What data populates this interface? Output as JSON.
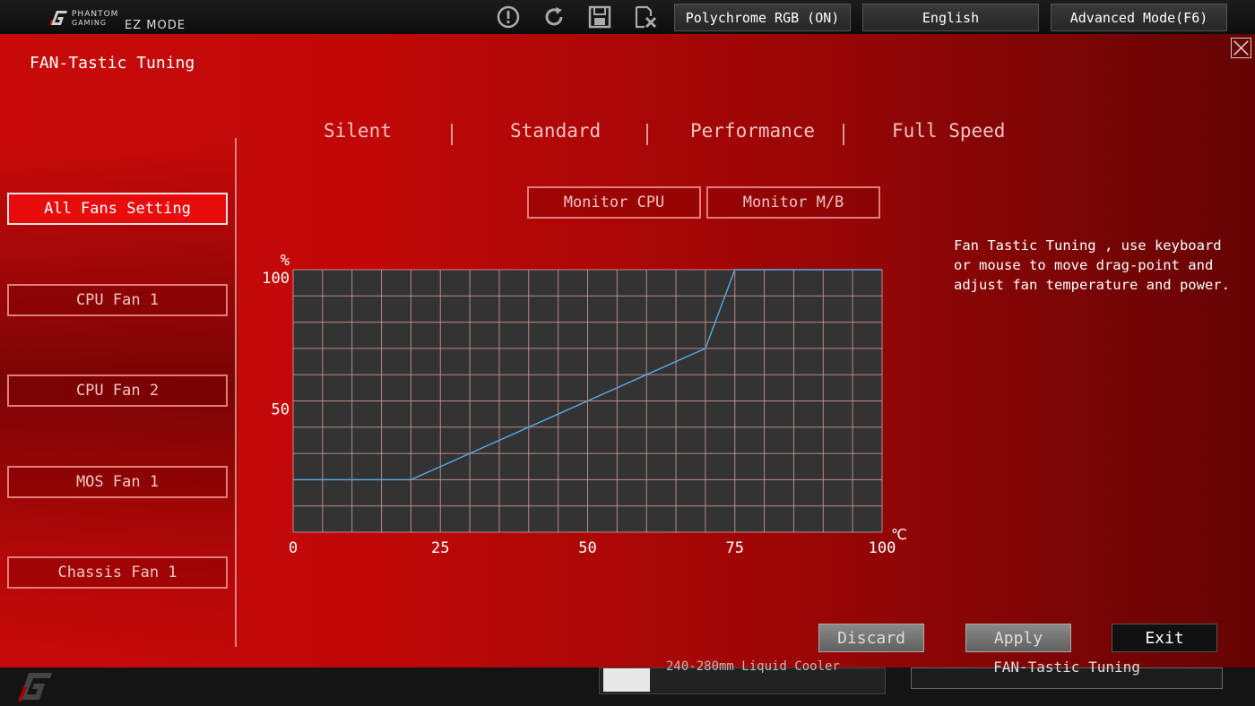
{
  "header": {
    "brand_line1": "PHANTOM",
    "brand_line2": "GAMING",
    "mode_label": "EZ MODE",
    "icons": [
      "warning-icon",
      "refresh-icon",
      "save-icon",
      "discard-icon"
    ],
    "polychrome_label": "Polychrome RGB (ON)",
    "language_label": "English",
    "advanced_label": "Advanced Mode(F6)"
  },
  "panel": {
    "title": "FAN-Tastic Tuning"
  },
  "fans": [
    {
      "label": "All Fans Setting",
      "active": true
    },
    {
      "label": "CPU Fan 1",
      "active": false
    },
    {
      "label": "CPU Fan 2",
      "active": false
    },
    {
      "label": "MOS Fan 1",
      "active": false
    },
    {
      "label": "Chassis Fan 1",
      "active": false
    }
  ],
  "modes": [
    "Silent",
    "Standard",
    "Performance",
    "Full Speed"
  ],
  "monitor": {
    "cpu_label": "Monitor CPU",
    "mb_label": "Monitor M/B"
  },
  "chart_data": {
    "type": "line",
    "ylabel": "%",
    "xlabel": "℃",
    "x_ticks": [
      "0",
      "25",
      "50",
      "75",
      "100"
    ],
    "y_ticks": [
      "100",
      "50"
    ],
    "xlim": [
      0,
      100
    ],
    "ylim": [
      0,
      100
    ],
    "grid": true,
    "series": [
      {
        "x": [
          0,
          20,
          70,
          75,
          100
        ],
        "y": [
          20,
          20,
          70,
          100,
          100
        ]
      }
    ],
    "colors": {
      "line": "#5aa9e6",
      "grid": "#e8a5a5",
      "plot_bg": "#333333"
    }
  },
  "description": "Fan Tastic Tuning , use keyboard\nor mouse to move drag-point and\nadjust fan temperature and power.",
  "actions": {
    "discard_label": "Discard",
    "apply_label": "Apply",
    "exit_label": "Exit"
  },
  "bottom": {
    "cooler_text": "240-280mm Liquid Cooler",
    "tuning_text": "FAN-Tastic Tuning"
  }
}
